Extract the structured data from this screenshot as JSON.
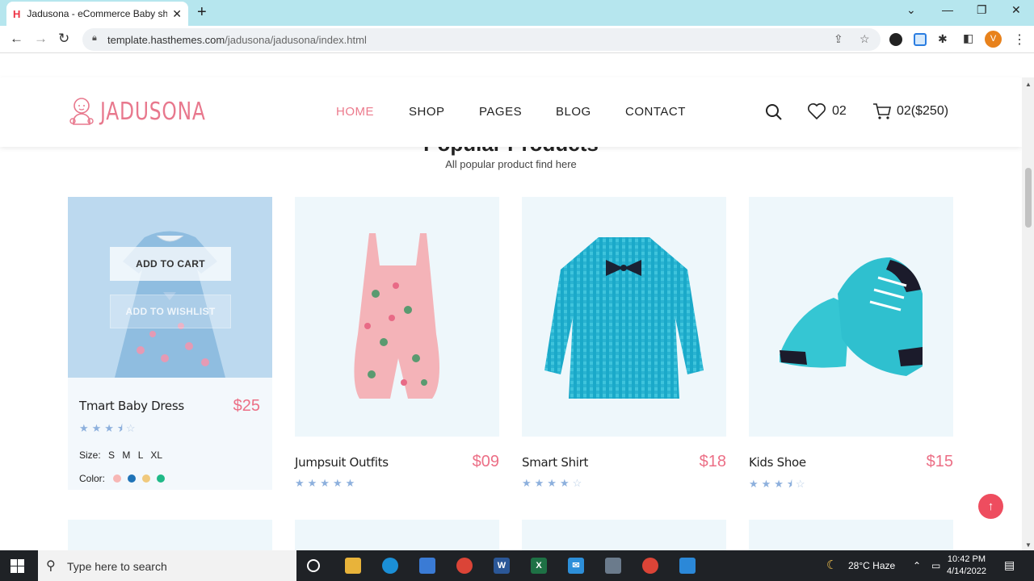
{
  "browser": {
    "tab_title": "Jadusona - eCommerce Baby sho",
    "tab_favicon": "H",
    "url_host": "template.hasthemes.com",
    "url_path": "/jadusona/jadusona/index.html",
    "profile_initial": "V"
  },
  "site": {
    "logo_text": "JADUSONA",
    "nav": [
      "HOME",
      "SHOP",
      "PAGES",
      "BLOG",
      "CONTACT"
    ],
    "wishlist_count": "02",
    "cart_summary": "02($250)"
  },
  "section": {
    "title": "Popular Products",
    "subtitle": "All popular product find here"
  },
  "overlay": {
    "add_to_cart": "ADD TO CART",
    "add_to_wishlist": "ADD TO WISHLIST"
  },
  "products": [
    {
      "name": "Tmart Baby Dress",
      "price": "$25",
      "rating": 3.5
    },
    {
      "name": "Jumpsuit Outfits",
      "price": "$09",
      "rating": 5
    },
    {
      "name": "Smart Shirt",
      "price": "$18",
      "rating": 4
    },
    {
      "name": "Kids Shoe",
      "price": "$15",
      "rating": 3.5
    }
  ],
  "variants": {
    "size_label": "Size:",
    "sizes": [
      "S",
      "M",
      "L",
      "XL"
    ],
    "color_label": "Color:",
    "colors": [
      "#f7b7b5",
      "#1f73b7",
      "#f0c97d",
      "#1fb987"
    ]
  },
  "taskbar": {
    "search_placeholder": "Type here to search",
    "weather": "28°C  Haze",
    "time": "10:42 PM",
    "date": "4/14/2022"
  },
  "colors": {
    "accent": "#ec7a8c",
    "tabbar": "#b6e6ee",
    "back_to_top": "#ee4d5f"
  }
}
